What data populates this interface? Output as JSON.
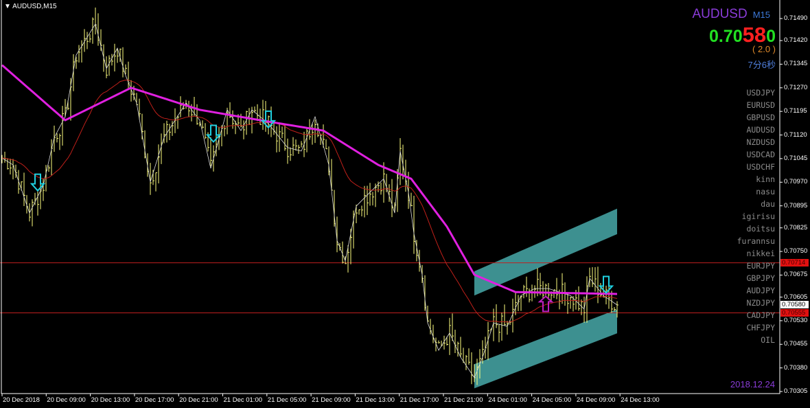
{
  "window": {
    "title": "AUDUSD,M15"
  },
  "info": {
    "symbol": "AUDUSD",
    "timeframe": "M15",
    "bid_prefix": "0.70",
    "bid_big": "58",
    "bid_suffix": "0",
    "spread": "( 2.0 )",
    "timer": "7分6秒",
    "date": "2018.12.24"
  },
  "watchlist": [
    "USDJPY",
    "EURUSD",
    "GBPUSD",
    "AUDUSD",
    "NZDUSD",
    "USDCAD",
    "USDCHF",
    "kinn",
    "nasu",
    "dau",
    "igirisu",
    "doitsu",
    "furannsu",
    "nikkei",
    "EURJPY",
    "GBPJPY",
    "AUDJPY",
    "NZDJPY",
    "CADJPY",
    "CHFJPY",
    "OIL"
  ],
  "price_labels": {
    "line1": "0.70714",
    "current": "0.70580",
    "line2": "0.70555"
  },
  "colors": {
    "bars": "#ffff80",
    "ma_slow": "#e020e0",
    "ma_fast": "#c0201a",
    "channel": "#3d9090",
    "hline": "#c02020",
    "signal_down": "#20d0e0",
    "signal_up": "#c020c0"
  },
  "chart_data": {
    "type": "bar",
    "symbol": "AUDUSD",
    "timeframe": "M15",
    "ylim": [
      0.7029,
      0.7152
    ],
    "y_ticks": [
      "0.71490",
      "0.71420",
      "0.71345",
      "0.71270",
      "0.71195",
      "0.71120",
      "0.71045",
      "0.70970",
      "0.70895",
      "0.70825",
      "0.70750",
      "0.70675",
      "0.70605",
      "0.70530",
      "0.70455",
      "0.70380",
      "0.70305"
    ],
    "x_ticks": [
      "20 Dec 2018",
      "20 Dec 09:00",
      "20 Dec 13:00",
      "20 Dec 17:00",
      "20 Dec 21:00",
      "21 Dec 01:00",
      "21 Dec 05:00",
      "21 Dec 09:00",
      "21 Dec 13:00",
      "21 Dec 17:00",
      "21 Dec 21:00",
      "24 Dec 01:00",
      "24 Dec 05:00",
      "24 Dec 09:00",
      "24 Dec 13:00"
    ],
    "key_closes": [
      [
        0,
        0.71047
      ],
      [
        4,
        0.71025
      ],
      [
        10,
        0.70872
      ],
      [
        15,
        0.7096
      ],
      [
        19,
        0.71112
      ],
      [
        23,
        0.71178
      ],
      [
        27,
        0.71374
      ],
      [
        34,
        0.71473
      ],
      [
        38,
        0.71331
      ],
      [
        42,
        0.71396
      ],
      [
        45,
        0.71309
      ],
      [
        49,
        0.71222
      ],
      [
        54,
        0.70971
      ],
      [
        59,
        0.71112
      ],
      [
        67,
        0.71222
      ],
      [
        72,
        0.71167
      ],
      [
        76,
        0.71014
      ],
      [
        82,
        0.712
      ],
      [
        87,
        0.71134
      ],
      [
        91,
        0.712
      ],
      [
        97,
        0.71156
      ],
      [
        104,
        0.7108
      ],
      [
        109,
        0.71069
      ],
      [
        114,
        0.71178
      ],
      [
        119,
        0.71025
      ],
      [
        122,
        0.70785
      ],
      [
        125,
        0.7072
      ],
      [
        129,
        0.70894
      ],
      [
        134,
        0.70938
      ],
      [
        139,
        0.70981
      ],
      [
        143,
        0.70872
      ],
      [
        145,
        0.71069
      ],
      [
        148,
        0.70938
      ],
      [
        150,
        0.70807
      ],
      [
        153,
        0.70676
      ],
      [
        155,
        0.70523
      ],
      [
        159,
        0.70436
      ],
      [
        163,
        0.70491
      ],
      [
        167,
        0.70414
      ],
      [
        172,
        0.70349
      ],
      [
        175,
        0.70414
      ],
      [
        179,
        0.70523
      ],
      [
        184,
        0.70512
      ],
      [
        189,
        0.7061
      ],
      [
        194,
        0.70632
      ],
      [
        199,
        0.70632
      ],
      [
        207,
        0.7061
      ],
      [
        212,
        0.70567
      ],
      [
        214,
        0.70665
      ],
      [
        219,
        0.7061
      ],
      [
        224,
        0.7058
      ]
    ],
    "ma_slow": [
      [
        0,
        0.71342
      ],
      [
        23,
        0.71167
      ],
      [
        47,
        0.7127
      ],
      [
        72,
        0.712
      ],
      [
        94,
        0.71167
      ],
      [
        117,
        0.71134
      ],
      [
        137,
        0.71025
      ],
      [
        149,
        0.70981
      ],
      [
        162,
        0.70829
      ],
      [
        172,
        0.70676
      ],
      [
        187,
        0.70621
      ],
      [
        224,
        0.70615
      ]
    ],
    "horizontal_lines": [
      0.70714,
      0.70555
    ],
    "current_price": 0.7058,
    "signals": [
      {
        "bar": 13,
        "price": 0.70965,
        "dir": "down"
      },
      {
        "bar": 77,
        "price": 0.7112,
        "dir": "down"
      },
      {
        "bar": 97,
        "price": 0.71165,
        "dir": "down"
      },
      {
        "bar": 198,
        "price": 0.7059,
        "dir": "up"
      },
      {
        "bar": 220,
        "price": 0.7064,
        "dir": "down"
      }
    ],
    "channels": [
      {
        "from": [
          172,
          0.70687,
          0.7061
        ],
        "to": [
          224,
          0.70886,
          0.70805
        ]
      },
      {
        "from": [
          172,
          0.70392,
          0.70315
        ],
        "to": [
          224,
          0.70566,
          0.7049
        ]
      }
    ]
  }
}
